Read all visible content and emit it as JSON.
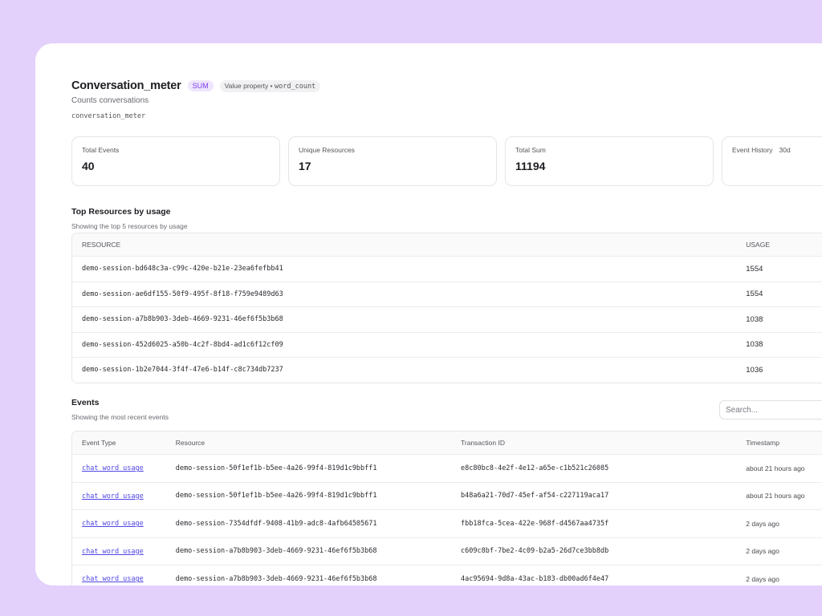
{
  "meter": {
    "name": "Conversation_meter",
    "aggregation": "SUM",
    "value_property_label": "Value property •",
    "value_property": "word_count",
    "description": "Counts conversations",
    "slug": "conversation_meter"
  },
  "stats": [
    {
      "label": "Total Events",
      "value": "40"
    },
    {
      "label": "Unique Resources",
      "value": "17"
    },
    {
      "label": "Total Sum",
      "value": "11194"
    },
    {
      "label": "Event History",
      "extra": "30d",
      "value": ""
    }
  ],
  "top_resources": {
    "title": "Top Resources by usage",
    "subtitle": "Showing the top 5 resources by usage",
    "headers": [
      "RESOURCE",
      "USAGE"
    ],
    "rows": [
      {
        "resource": "demo-session-bd648c3a-c99c-420e-b21e-23ea6fefbb41",
        "usage": "1554"
      },
      {
        "resource": "demo-session-ae6df155-50f9-495f-8f18-f759e9489d63",
        "usage": "1554"
      },
      {
        "resource": "demo-session-a7b8b903-3deb-4669-9231-46ef6f5b3b68",
        "usage": "1038"
      },
      {
        "resource": "demo-session-452d6025-a50b-4c2f-8bd4-ad1c6f12cf09",
        "usage": "1038"
      },
      {
        "resource": "demo-session-1b2e7044-3f4f-47e6-b14f-c8c734db7237",
        "usage": "1036"
      }
    ]
  },
  "events": {
    "title": "Events",
    "subtitle": "Showing the most recent events",
    "search_placeholder": "Search...",
    "headers": [
      "Event Type",
      "Resource",
      "Transaction ID",
      "Timestamp"
    ],
    "rows": [
      {
        "type": "chat_word_usage",
        "resource": "demo-session-50f1ef1b-b5ee-4a26-99f4-819d1c9bbff1",
        "txn": "e8c80bc8-4e2f-4e12-a65e-c1b521c26085",
        "ts": "about 21 hours ago"
      },
      {
        "type": "chat_word_usage",
        "resource": "demo-session-50f1ef1b-b5ee-4a26-99f4-819d1c9bbff1",
        "txn": "b48a6a21-70d7-45ef-af54-c227119aca17",
        "ts": "about 21 hours ago"
      },
      {
        "type": "chat_word_usage",
        "resource": "demo-session-7354dfdf-9408-41b9-adc8-4afb64505671",
        "txn": "fbb18fca-5cea-422e-968f-d4567aa4735f",
        "ts": "2 days ago"
      },
      {
        "type": "chat_word_usage",
        "resource": "demo-session-a7b8b903-3deb-4669-9231-46ef6f5b3b68",
        "txn": "c609c8bf-7be2-4c09-b2a5-26d7ce3bb8db",
        "ts": "2 days ago"
      },
      {
        "type": "chat_word_usage",
        "resource": "demo-session-a7b8b903-3deb-4669-9231-46ef6f5b3b68",
        "txn": "4ac95694-9d8a-43ac-b183-db00ad6f4e47",
        "ts": "2 days ago"
      }
    ]
  }
}
